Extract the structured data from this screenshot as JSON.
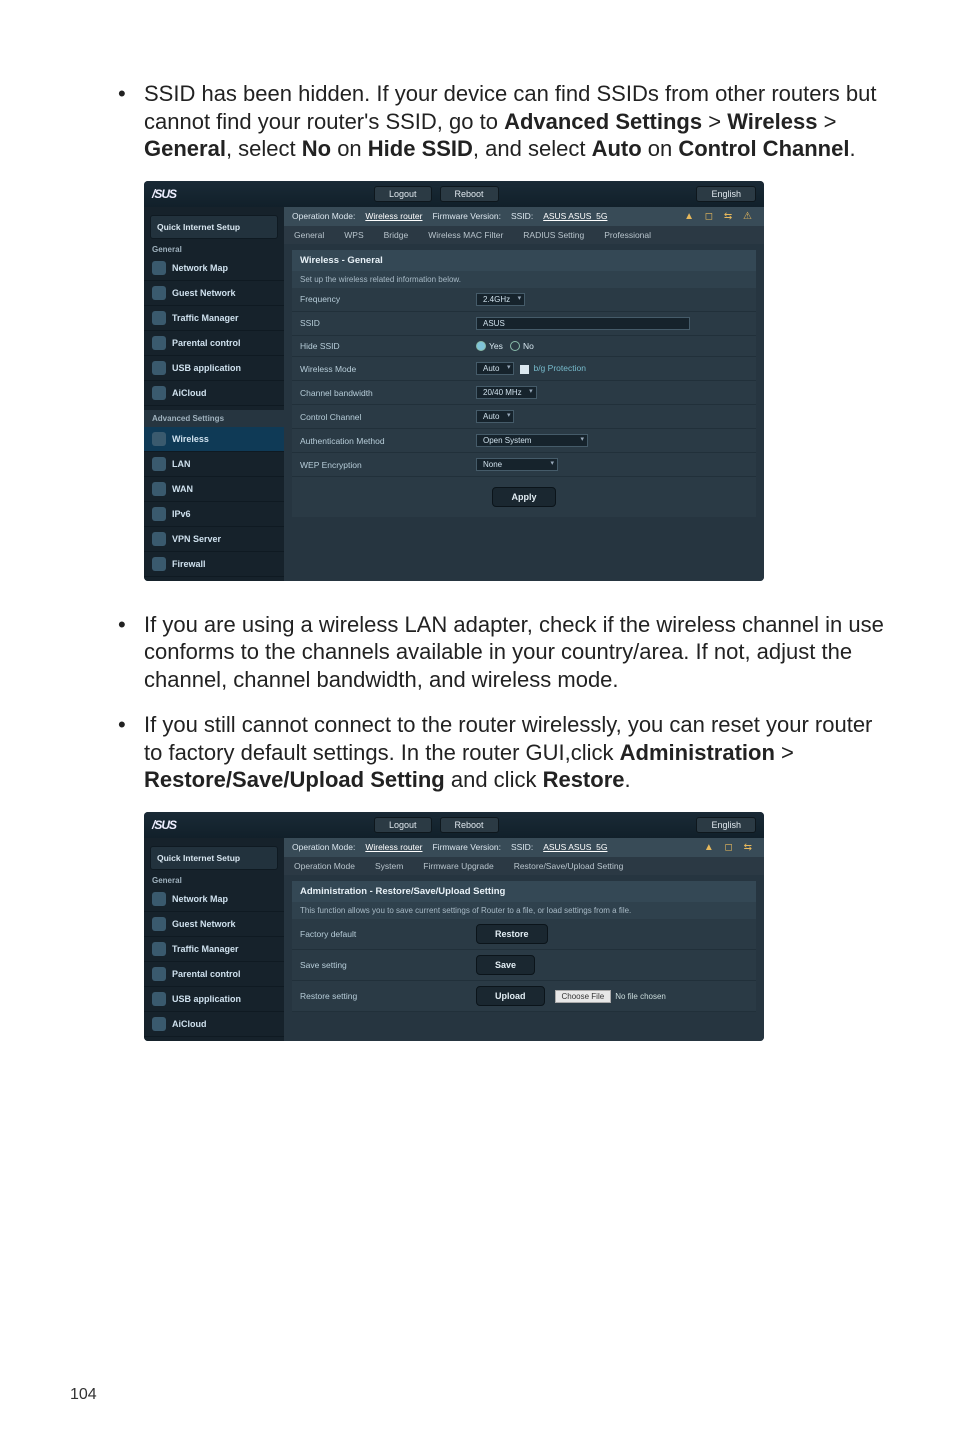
{
  "paragraphs": {
    "p1_a": "SSID has been hidden. If your device can find SSIDs from other routers but cannot find your router's SSID, go to ",
    "p1_b": "Advanced Settings",
    "p1_c": " > ",
    "p1_d": "Wireless",
    "p1_e": " > ",
    "p1_f": "General",
    "p1_g": ", select ",
    "p1_h": "No",
    "p1_i": " on ",
    "p1_j": "Hide SSID",
    "p1_k": ", and select ",
    "p1_l": "Auto",
    "p1_m": " on ",
    "p1_n": "Control Channel",
    "p1_o": ".",
    "p2": "If you are using a wireless LAN adapter, check if the wireless channel in use conforms to the channels available in your country/area. If not, adjust the channel, channel bandwidth, and wireless mode.",
    "p3_a": "If you still cannot connect to the router wirelessly, you can reset your router to factory default settings. In the router GUI,click ",
    "p3_b": "Administration",
    "p3_c": " > ",
    "p3_d": "Restore/Save/Upload Setting",
    "p3_e": " and click ",
    "p3_f": "Restore",
    "p3_g": "."
  },
  "page_number": "104",
  "shot1": {
    "brand": "/SUS",
    "logout": "Logout",
    "reboot": "Reboot",
    "english": "English",
    "op_mode_label": "Operation Mode:",
    "op_mode_val": "Wireless router",
    "fw_label": "Firmware Version:",
    "ssid_label": "SSID:",
    "ssid_val": "ASUS  ASUS_5G",
    "tabs": [
      "General",
      "WPS",
      "Bridge",
      "Wireless MAC Filter",
      "RADIUS Setting",
      "Professional"
    ],
    "qis": "Quick Internet Setup",
    "side_general": "General",
    "side_items": [
      "Network Map",
      "Guest Network",
      "Traffic Manager",
      "Parental control",
      "USB application",
      "AiCloud"
    ],
    "side_adv": "Advanced Settings",
    "side_adv_items": [
      "Wireless",
      "LAN",
      "WAN",
      "IPv6",
      "VPN Server",
      "Firewall"
    ],
    "panel_title": "Wireless - General",
    "panel_sub": "Set up the wireless related information below.",
    "rows": {
      "frequency": {
        "label": "Frequency",
        "val": "2.4GHz"
      },
      "ssid": {
        "label": "SSID",
        "val": "ASUS"
      },
      "hide": {
        "label": "Hide SSID",
        "yes": "Yes",
        "no": "No"
      },
      "mode": {
        "label": "Wireless Mode",
        "val": "Auto",
        "opt": "b/g Protection"
      },
      "bw": {
        "label": "Channel bandwidth",
        "val": "20/40 MHz"
      },
      "ch": {
        "label": "Control Channel",
        "val": "Auto"
      },
      "auth": {
        "label": "Authentication Method",
        "val": "Open System"
      },
      "wep": {
        "label": "WEP Encryption",
        "val": "None"
      }
    },
    "apply": "Apply"
  },
  "shot2": {
    "brand": "/SUS",
    "logout": "Logout",
    "reboot": "Reboot",
    "english": "English",
    "op_mode_label": "Operation Mode:",
    "op_mode_val": "Wireless router",
    "fw_label": "Firmware Version:",
    "ssid_label": "SSID:",
    "ssid_val": "ASUS  ASUS_5G",
    "tabs": [
      "Operation Mode",
      "System",
      "Firmware Upgrade",
      "Restore/Save/Upload Setting"
    ],
    "qis": "Quick Internet Setup",
    "side_general": "General",
    "side_items": [
      "Network Map",
      "Guest Network",
      "Traffic Manager",
      "Parental control",
      "USB application",
      "AiCloud"
    ],
    "panel_title": "Administration - Restore/Save/Upload Setting",
    "panel_sub": "This function allows you to save current settings of Router to a file, or load settings from a file.",
    "rows": {
      "fd": {
        "label": "Factory default",
        "btn": "Restore"
      },
      "ss": {
        "label": "Save setting",
        "btn": "Save"
      },
      "rs": {
        "label": "Restore setting",
        "btn": "Upload",
        "file_btn": "Choose File",
        "file_txt": "No file chosen"
      }
    }
  }
}
